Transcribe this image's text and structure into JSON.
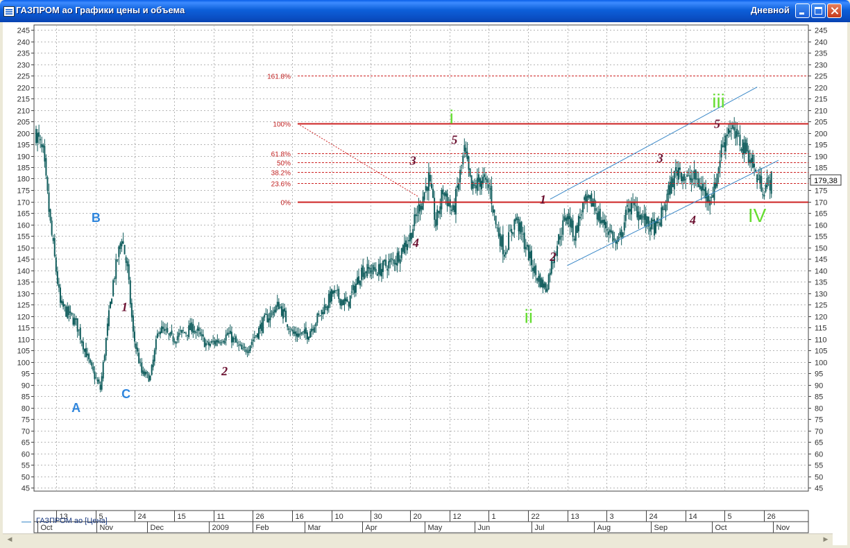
{
  "window": {
    "title": "ГАЗПРОМ ао Графики цены и объема",
    "period": "Дневной"
  },
  "legend": {
    "series_name": "ГАЗПРОМ ао [Цена]"
  },
  "colors": {
    "candles": "#0f5c5c",
    "grid": "#b4b4b4",
    "fib": "#cc2020",
    "fib_label": "#c02020",
    "channel": "#3a88c8",
    "wave_major": "#66dd33",
    "wave_minor": "#6b1030",
    "wave_abc": "#2f86dd"
  },
  "scrollbar": {
    "left_arrow": "◀",
    "right_arrow": "▶"
  },
  "chart_data": {
    "type": "candlestick",
    "title": "ГАЗПРОМ ао",
    "ylim": [
      45,
      245
    ],
    "y_ticks": [
      45,
      50,
      55,
      60,
      65,
      70,
      75,
      80,
      85,
      90,
      95,
      100,
      105,
      110,
      115,
      120,
      125,
      130,
      135,
      140,
      145,
      150,
      155,
      160,
      165,
      170,
      175,
      180,
      185,
      190,
      195,
      200,
      205,
      210,
      215,
      220,
      225,
      230,
      235,
      240,
      245
    ],
    "grid": true,
    "last_price_label": "179,38",
    "last_price": 179.38,
    "x_day_ticks": [
      "13",
      "5",
      "24",
      "15",
      "11",
      "26",
      "16",
      "10",
      "30",
      "20",
      "12",
      "1",
      "22",
      "13",
      "3",
      "24",
      "14",
      "5",
      "26"
    ],
    "x_month_ticks": [
      "Oct",
      "Nov",
      "Dec",
      "2009",
      "Feb",
      "Mar",
      "Apr",
      "May",
      "Jun",
      "Jul",
      "Aug",
      "Sep",
      "Oct",
      "Nov"
    ],
    "anchors": [
      {
        "t": 0,
        "p": 200
      },
      {
        "t": 5,
        "p": 190
      },
      {
        "t": 10,
        "p": 160
      },
      {
        "t": 17,
        "p": 125
      },
      {
        "t": 28,
        "p": 117
      },
      {
        "t": 38,
        "p": 98
      },
      {
        "t": 45,
        "p": 88
      },
      {
        "t": 50,
        "p": 115
      },
      {
        "t": 54,
        "p": 135
      },
      {
        "t": 60,
        "p": 155
      },
      {
        "t": 64,
        "p": 140
      },
      {
        "t": 68,
        "p": 112
      },
      {
        "t": 74,
        "p": 95
      },
      {
        "t": 80,
        "p": 93
      },
      {
        "t": 86,
        "p": 115
      },
      {
        "t": 95,
        "p": 110
      },
      {
        "t": 110,
        "p": 115
      },
      {
        "t": 120,
        "p": 107
      },
      {
        "t": 135,
        "p": 112
      },
      {
        "t": 145,
        "p": 104
      },
      {
        "t": 150,
        "p": 108
      },
      {
        "t": 160,
        "p": 118
      },
      {
        "t": 170,
        "p": 125
      },
      {
        "t": 180,
        "p": 112
      },
      {
        "t": 190,
        "p": 112
      },
      {
        "t": 198,
        "p": 120
      },
      {
        "t": 208,
        "p": 130
      },
      {
        "t": 218,
        "p": 125
      },
      {
        "t": 228,
        "p": 140
      },
      {
        "t": 240,
        "p": 140
      },
      {
        "t": 252,
        "p": 145
      },
      {
        "t": 262,
        "p": 155
      },
      {
        "t": 267,
        "p": 165
      },
      {
        "t": 275,
        "p": 180
      },
      {
        "t": 280,
        "p": 160
      },
      {
        "t": 285,
        "p": 175
      },
      {
        "t": 292,
        "p": 165
      },
      {
        "t": 300,
        "p": 192
      },
      {
        "t": 305,
        "p": 175
      },
      {
        "t": 312,
        "p": 180
      },
      {
        "t": 318,
        "p": 175
      },
      {
        "t": 322,
        "p": 160
      },
      {
        "t": 328,
        "p": 148
      },
      {
        "t": 336,
        "p": 163
      },
      {
        "t": 342,
        "p": 152
      },
      {
        "t": 350,
        "p": 138
      },
      {
        "t": 357,
        "p": 132
      },
      {
        "t": 363,
        "p": 148
      },
      {
        "t": 372,
        "p": 165
      },
      {
        "t": 377,
        "p": 155
      },
      {
        "t": 383,
        "p": 168
      },
      {
        "t": 390,
        "p": 170
      },
      {
        "t": 395,
        "p": 162
      },
      {
        "t": 402,
        "p": 157
      },
      {
        "t": 407,
        "p": 150
      },
      {
        "t": 415,
        "p": 168
      },
      {
        "t": 422,
        "p": 166
      },
      {
        "t": 428,
        "p": 160
      },
      {
        "t": 435,
        "p": 158
      },
      {
        "t": 440,
        "p": 168
      },
      {
        "t": 445,
        "p": 178
      },
      {
        "t": 450,
        "p": 185
      },
      {
        "t": 455,
        "p": 180
      },
      {
        "t": 462,
        "p": 180
      },
      {
        "t": 470,
        "p": 172
      },
      {
        "t": 475,
        "p": 175
      },
      {
        "t": 480,
        "p": 193
      },
      {
        "t": 485,
        "p": 203
      },
      {
        "t": 490,
        "p": 198
      },
      {
        "t": 495,
        "p": 195
      },
      {
        "t": 500,
        "p": 190
      },
      {
        "t": 505,
        "p": 180
      },
      {
        "t": 510,
        "p": 176
      },
      {
        "t": 515,
        "p": 179.38
      }
    ],
    "fibonacci": {
      "base_price": 170,
      "top_price": 204,
      "levels": [
        {
          "label": "0%",
          "price": 170
        },
        {
          "label": "23.6%",
          "price": 178
        },
        {
          "label": "38.2%",
          "price": 183
        },
        {
          "label": "50%",
          "price": 187
        },
        {
          "label": "61.8%",
          "price": 191
        },
        {
          "label": "100%",
          "price": 204
        },
        {
          "label": "161.8%",
          "price": 225
        }
      ],
      "diagonal": {
        "from_t": 172,
        "from_p": 204,
        "to_t": 268,
        "to_p": 172
      }
    },
    "channel_lines": [
      {
        "t1": 360,
        "p1": 171,
        "t2": 505,
        "p2": 220
      },
      {
        "t1": 372,
        "p1": 142,
        "t2": 520,
        "p2": 188
      }
    ],
    "annotations": [
      {
        "text": "A",
        "t": 28,
        "p": 80,
        "group": "abc"
      },
      {
        "text": "B",
        "t": 42,
        "p": 163,
        "group": "abc"
      },
      {
        "text": "C",
        "t": 63,
        "p": 86,
        "group": "abc"
      },
      {
        "text": "1",
        "t": 62,
        "p": 124,
        "group": "minor"
      },
      {
        "text": "2",
        "t": 132,
        "p": 96,
        "group": "minor"
      },
      {
        "text": "3",
        "t": 264,
        "p": 188,
        "group": "minor"
      },
      {
        "text": "4",
        "t": 266,
        "p": 152,
        "group": "minor"
      },
      {
        "text": "5",
        "t": 293,
        "p": 197,
        "group": "minor"
      },
      {
        "text": "i",
        "t": 291,
        "p": 207,
        "group": "major"
      },
      {
        "text": "ii",
        "t": 345,
        "p": 120,
        "group": "major"
      },
      {
        "text": "1",
        "t": 355,
        "p": 171,
        "group": "minor"
      },
      {
        "text": "2",
        "t": 362,
        "p": 146,
        "group": "minor"
      },
      {
        "text": "3",
        "t": 437,
        "p": 189,
        "group": "minor"
      },
      {
        "text": "4",
        "t": 460,
        "p": 162,
        "group": "minor"
      },
      {
        "text": "5",
        "t": 477,
        "p": 204,
        "group": "minor"
      },
      {
        "text": "iii",
        "t": 478,
        "p": 214,
        "group": "major"
      },
      {
        "text": "IV",
        "t": 505,
        "p": 164,
        "group": "major"
      }
    ]
  }
}
